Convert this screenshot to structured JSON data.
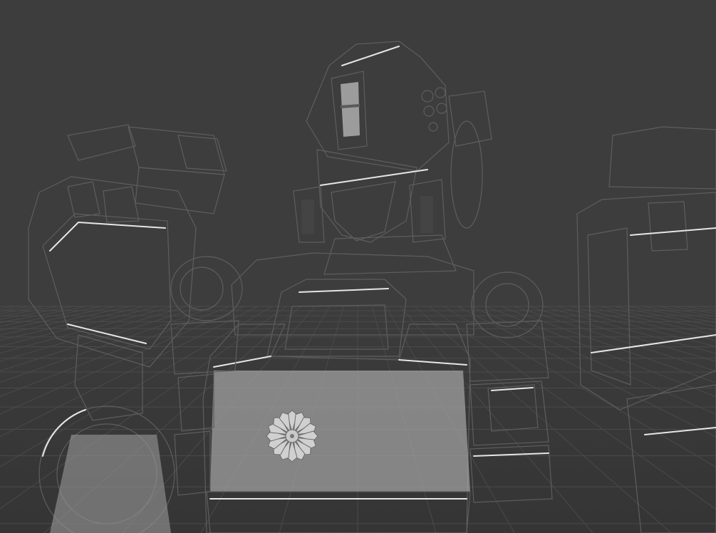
{
  "viewport": {
    "background_color": "#3d3d3d",
    "grid_color": "#4a4a4a",
    "model_color": "#9d9d9d",
    "model_highlight": "#d0d0d0",
    "model_shadow": "#6b6b6b",
    "emblem_icon": "chrysanthemum-emblem-icon"
  }
}
